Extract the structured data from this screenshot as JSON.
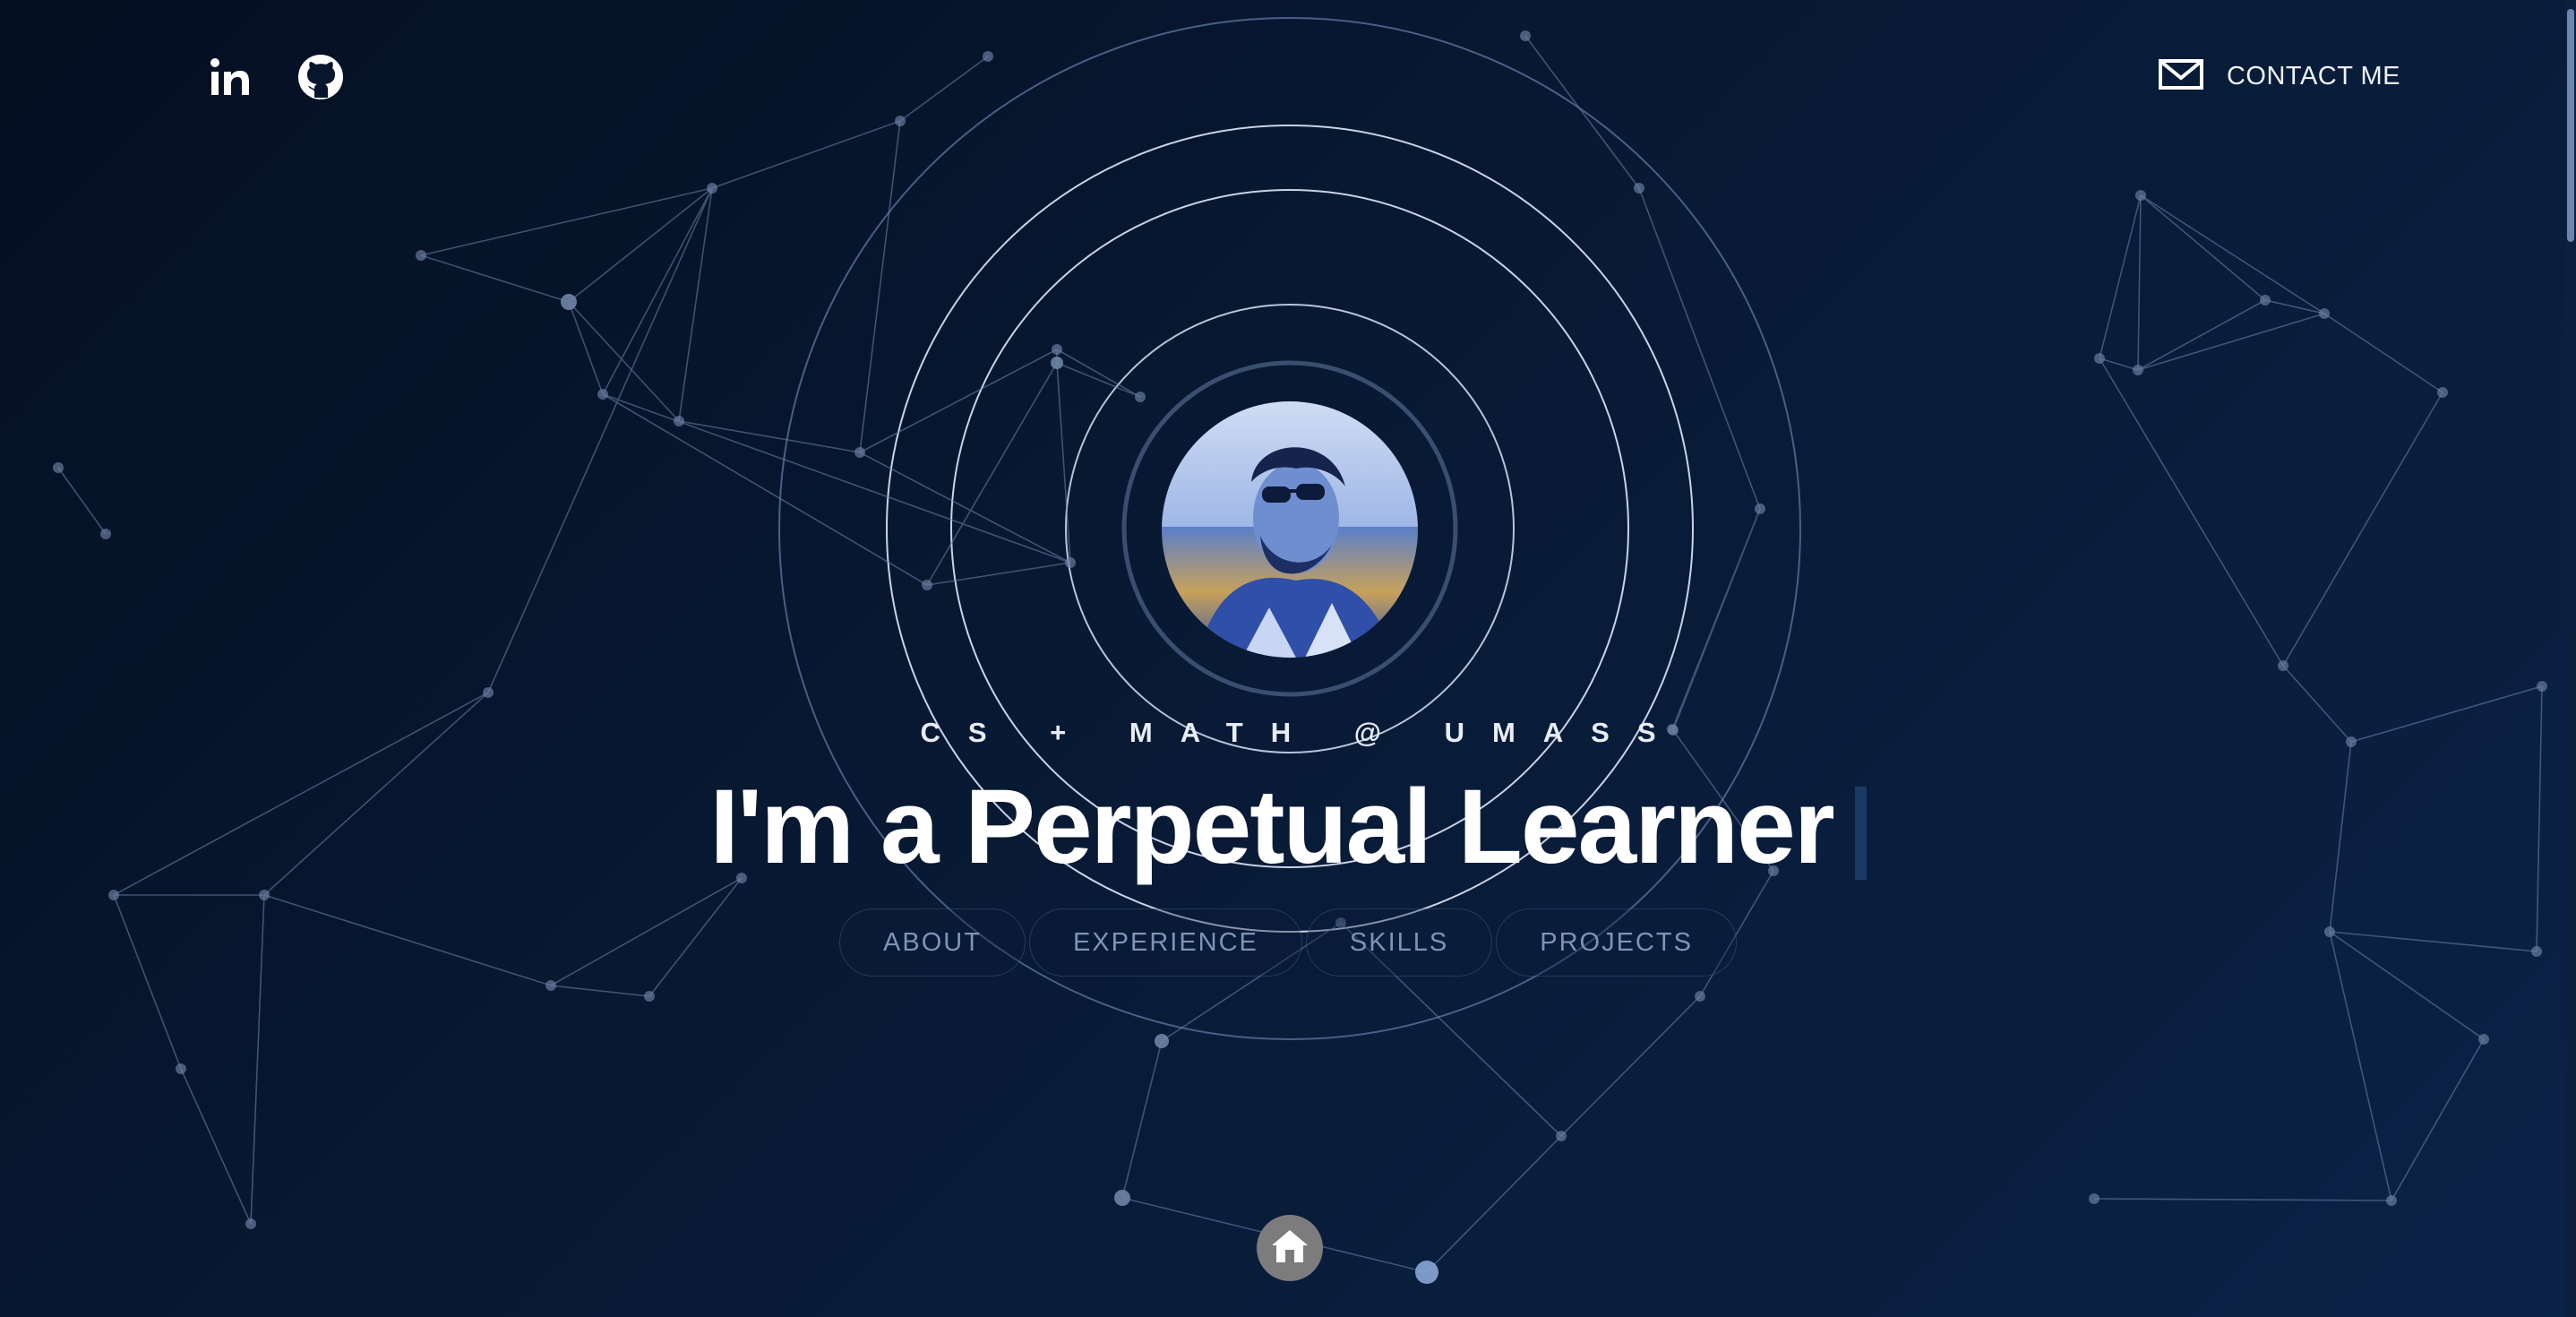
{
  "header": {
    "social": [
      {
        "name": "linkedin-icon",
        "glyph": "in"
      },
      {
        "name": "github-icon"
      }
    ],
    "contact": {
      "label": "CONTACT ME",
      "icon": "mail-icon"
    }
  },
  "hero": {
    "avatar_icon": "profile-photo",
    "tagline": "CS + MATH @ UMASS",
    "headline": "I'm a Perpetual Learner"
  },
  "nav": {
    "items": [
      {
        "label": "ABOUT"
      },
      {
        "label": "EXPERIENCE"
      },
      {
        "label": "SKILLS"
      },
      {
        "label": "PROJECTS"
      }
    ]
  },
  "footer": {
    "home_icon": "home-icon"
  },
  "colors": {
    "background": "#07152d",
    "accent": "#8aa6d6",
    "ring": "#c9d3e6",
    "nav_text": "#7f93b7",
    "home_button": "#7c7c7c"
  }
}
